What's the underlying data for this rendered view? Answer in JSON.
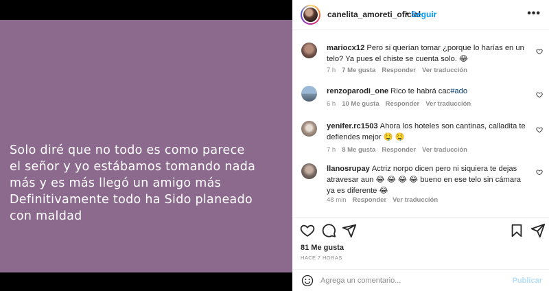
{
  "post": {
    "image_text": "Solo diré que no todo es como parece\nel señor y yo estábamos tomando nada\nmás y es más llegó un amigo más\nDefinitivamente todo ha Sido planeado\ncon maldad",
    "background_color": "#8b6a8e"
  },
  "header": {
    "username": "canelita_amoreti_oficial",
    "separator": "•",
    "follow_label": "Seguir",
    "more_icon": "more-horizontal-icon"
  },
  "comments": [
    {
      "username": "mariocx12",
      "text": "Pero si querían tomar ¿porque lo harías en un telo? Ya pues el chiste se cuenta solo. 😂",
      "time": "7 h",
      "likes": "7 Me gusta",
      "reply": "Responder",
      "translate": "Ver traducción"
    },
    {
      "username": "renzoparodi_one",
      "text": "Rico te habrá cac",
      "hashtag": "#ado",
      "time": "6 h",
      "likes": "10 Me gusta",
      "reply": "Responder",
      "translate": "Ver traducción"
    },
    {
      "username": "yenifer.rc1503",
      "text": "Ahora los hoteles son cantinas, calladita te defiendes mejor 🤤 🤤",
      "time": "7 h",
      "likes": "8 Me gusta",
      "reply": "Responder",
      "translate": "Ver traducción"
    },
    {
      "username": "llanosrupay",
      "text": "Actriz norpo dicen pero ni siquiera te dejas atravesar aun 😂 😂 😂 😂  bueno en ese telo sin cámara ya es diferente 😂",
      "time": "48 min",
      "reply": "Responder",
      "translate": "Ver traducción"
    }
  ],
  "actions": {
    "icons": [
      "heart-icon",
      "comment-icon",
      "share-icon",
      "save-icon"
    ],
    "likes": "81 Me gusta",
    "time_ago": "HACE 7 HORAS"
  },
  "add_comment": {
    "placeholder": "Agrega un comentario...",
    "publish_label": "Publicar",
    "emoji_icon": "emoji-icon"
  },
  "colors": {
    "link": "#0095f6",
    "publish_disabled": "#b2dffc",
    "meta": "#8e8e8e"
  }
}
